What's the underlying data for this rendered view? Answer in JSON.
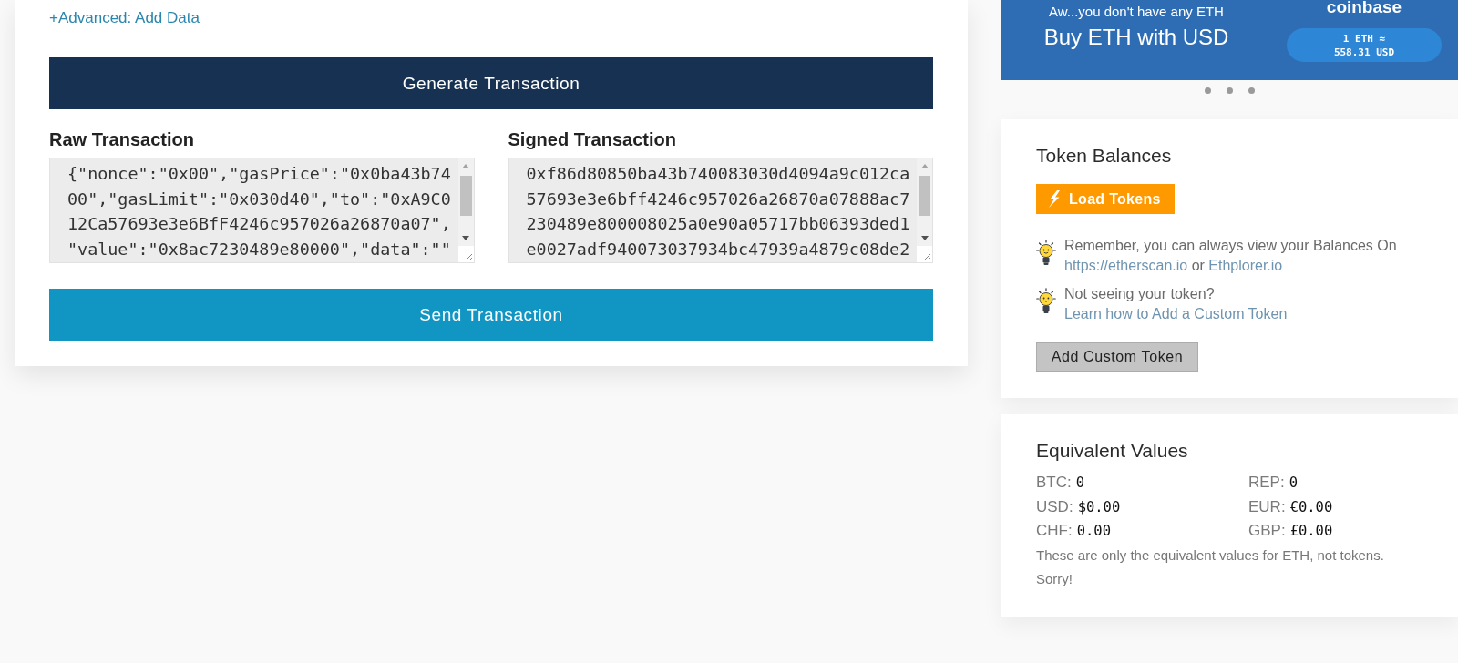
{
  "advanced_link": "+Advanced: Add Data",
  "generate_button": "Generate Transaction",
  "transactions": [
    {
      "label": "Raw Transaction",
      "value": "{\"nonce\":\"0x00\",\"gasPrice\":\"0x0ba43b7400\",\"gasLimit\":\"0x030d40\",\"to\":\"0xA9C012Ca57693e3e6BfF4246c957026a26870a07\",\"value\":\"0x8ac7230489e80000\",\"data\":\"\""
    },
    {
      "label": "Signed Transaction",
      "value": "0xf86d80850ba43b740083030d4094a9c012ca57693e3e6bff4246c957026a26870a07888ac7230489e800008025a0e90a05717bb06393ded1e0027adf940073037934bc47939a4879c08de2"
    }
  ],
  "send_button": "Send Transaction",
  "banner": {
    "subtitle": "Aw...you don't have any ETH",
    "title": "Buy ETH with USD",
    "brand": "coinbase",
    "rate_lines": [
      "1 ETH ≈",
      "558.31 USD"
    ]
  },
  "token_balances": {
    "title": "Token Balances",
    "load_button": "Load Tokens",
    "tips": [
      {
        "parts": [
          {
            "kind": "text",
            "text": "Remember, you can always view your Balances On"
          },
          {
            "kind": "link",
            "text": "https://etherscan.io"
          },
          {
            "kind": "text",
            "text": "or"
          },
          {
            "kind": "link",
            "text": "Ethplorer.io"
          }
        ]
      },
      {
        "parts": [
          {
            "kind": "text",
            "text": "Not seeing your token?"
          },
          {
            "kind": "link",
            "text": "Learn how to Add a Custom Token"
          }
        ]
      }
    ],
    "add_button": "Add Custom Token"
  },
  "equivalent_values": {
    "title": "Equivalent Values",
    "rows": [
      {
        "label": "BTC:",
        "value": "0"
      },
      {
        "label": "REP:",
        "value": "0"
      },
      {
        "label": "USD:",
        "value": "$0.00"
      },
      {
        "label": "EUR:",
        "value": "€0.00"
      },
      {
        "label": "CHF:",
        "value": "0.00"
      },
      {
        "label": "GBP:",
        "value": "£0.00"
      }
    ],
    "note": "These are only the equivalent values for ETH, not tokens. Sorry!"
  }
}
